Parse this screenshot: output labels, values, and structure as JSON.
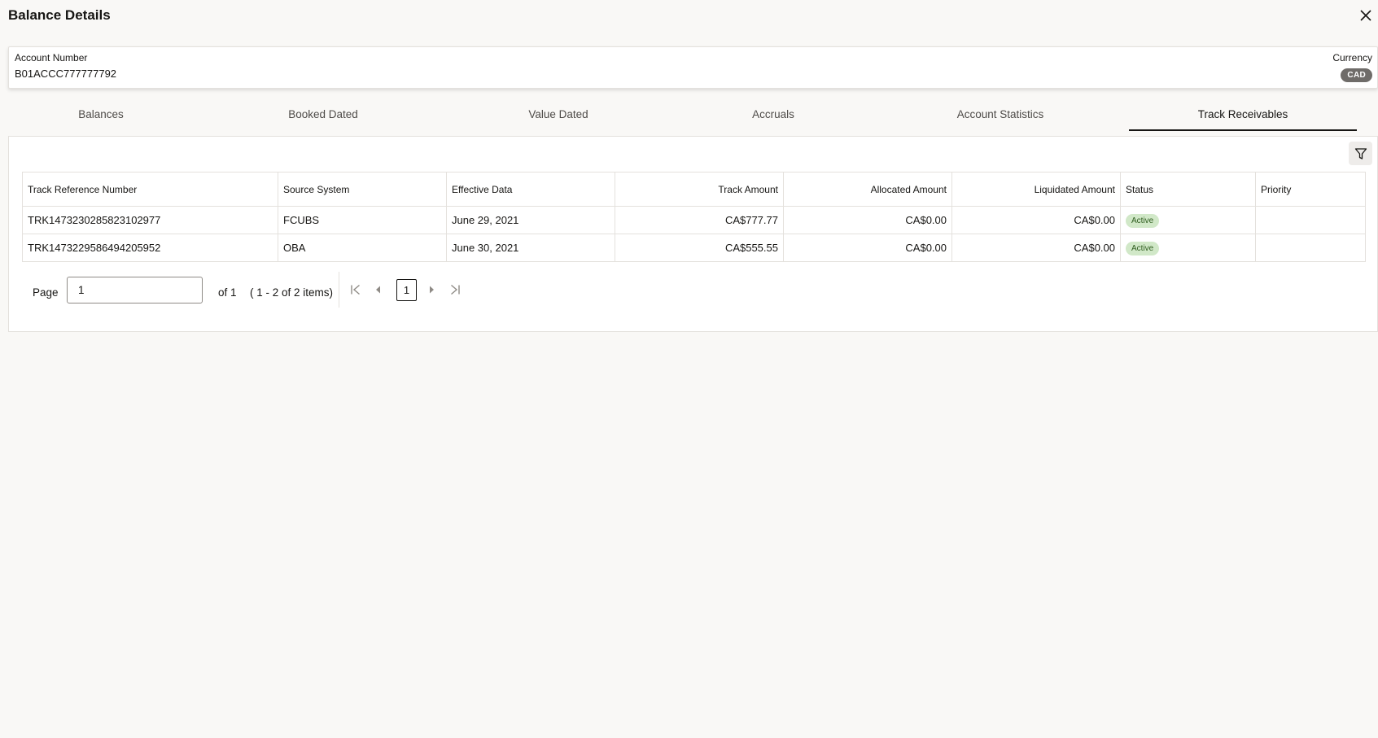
{
  "dialog": {
    "title": "Balance Details"
  },
  "account": {
    "number_label": "Account Number",
    "number_value": "B01ACCC777777792",
    "currency_label": "Currency",
    "currency_value": "CAD"
  },
  "tabs": [
    {
      "label": "Balances",
      "selected": false
    },
    {
      "label": "Booked Dated",
      "selected": false
    },
    {
      "label": "Value Dated",
      "selected": false
    },
    {
      "label": "Accruals",
      "selected": false
    },
    {
      "label": "Account Statistics",
      "selected": false
    },
    {
      "label": "Track Receivables",
      "selected": true
    }
  ],
  "table": {
    "headers": {
      "ref": "Track Reference Number",
      "source": "Source System",
      "effective": "Effective Data",
      "track_amount": "Track Amount",
      "allocated": "Allocated Amount",
      "liquidated": "Liquidated Amount",
      "status": "Status",
      "priority": "Priority"
    },
    "rows": [
      {
        "ref": "TRK1473230285823102977",
        "source": "FCUBS",
        "effective": "June 29, 2021",
        "track_amount": "CA$777.77",
        "allocated": "CA$0.00",
        "liquidated": "CA$0.00",
        "status": "Active",
        "priority": ""
      },
      {
        "ref": "TRK1473229586494205952",
        "source": "OBA",
        "effective": "June 30, 2021",
        "track_amount": "CA$555.55",
        "allocated": "CA$0.00",
        "liquidated": "CA$0.00",
        "status": "Active",
        "priority": ""
      }
    ]
  },
  "pagination": {
    "page_label": "Page",
    "page_value": "1",
    "of_text": "of 1",
    "range_text": "( 1 - 2 of 2 items)",
    "current_page": "1"
  },
  "icons": {
    "close": "close-icon",
    "filter": "filter-icon",
    "first": "first-page-icon",
    "prev": "previous-page-icon",
    "next": "next-page-icon",
    "last": "last-page-icon"
  },
  "colors": {
    "background": "#f9f8f6",
    "status_active_bg": "#d1e8c8",
    "currency_badge_bg": "#6f6c69",
    "selected_tab_underline": "#161513"
  }
}
